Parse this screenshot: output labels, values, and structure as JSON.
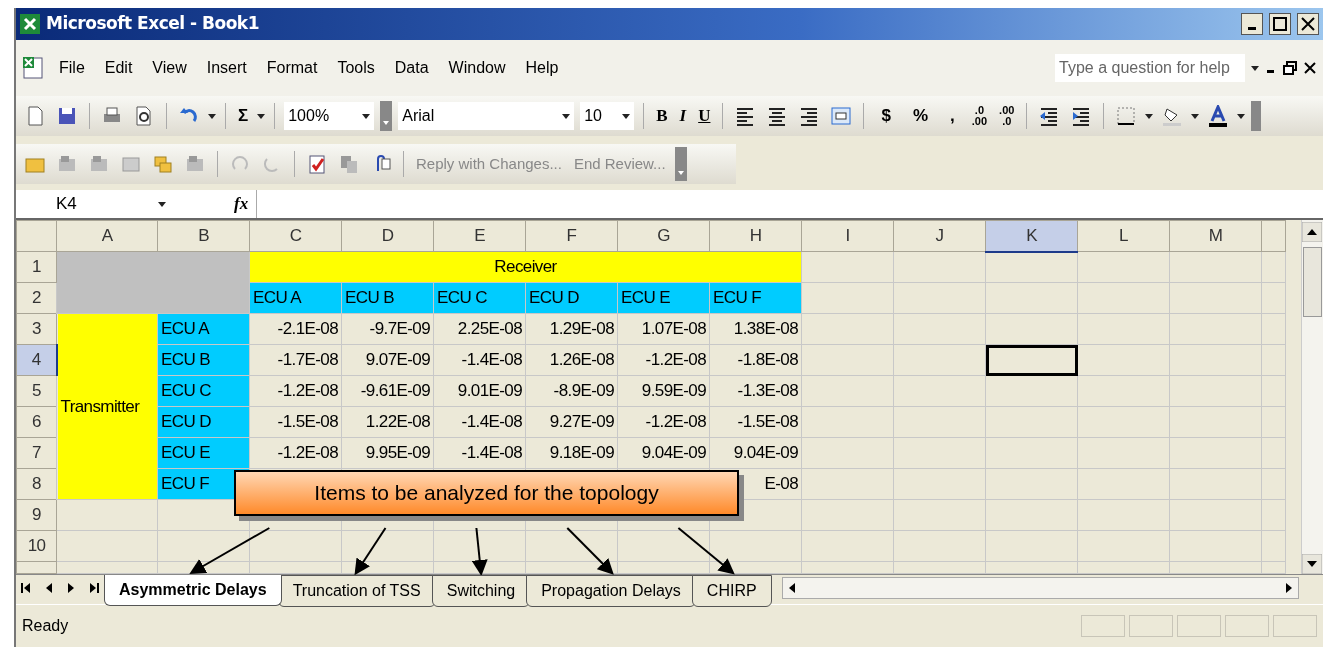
{
  "window": {
    "title": "Microsoft Excel - Book1"
  },
  "menu": [
    "File",
    "Edit",
    "View",
    "Insert",
    "Format",
    "Tools",
    "Data",
    "Window",
    "Help"
  ],
  "help_box": {
    "placeholder": "Type a question for help"
  },
  "toolbar": {
    "sum": "Σ",
    "zoom": "100%",
    "font": "Arial",
    "size": "10",
    "styles": [
      "B",
      "I",
      "U"
    ],
    "number_formats": [
      "$",
      "%",
      ","
    ],
    "increase_decimal": [
      ".0",
      ".00"
    ],
    "decrease_decimal": [
      ".00",
      ".0"
    ]
  },
  "review_toolbar": [
    "Reply with Changes...",
    "End Review..."
  ],
  "name_box": "K4",
  "formula_label": "fx",
  "grid": {
    "columns": [
      {
        "label": "A",
        "selected": false
      },
      {
        "label": "B",
        "selected": false
      },
      {
        "label": "C",
        "selected": false
      },
      {
        "label": "D",
        "selected": false
      },
      {
        "label": "E",
        "selected": false
      },
      {
        "label": "F",
        "selected": false
      },
      {
        "label": "G",
        "selected": false
      },
      {
        "label": "H",
        "selected": false
      },
      {
        "label": "I",
        "selected": false
      },
      {
        "label": "J",
        "selected": false
      },
      {
        "label": "K",
        "selected": true
      },
      {
        "label": "L",
        "selected": false
      },
      {
        "label": "M",
        "selected": false
      }
    ],
    "rows": [
      {
        "label": "1",
        "selected": false
      },
      {
        "label": "2",
        "selected": false
      },
      {
        "label": "3",
        "selected": false
      },
      {
        "label": "4",
        "selected": true
      },
      {
        "label": "5",
        "selected": false
      },
      {
        "label": "6",
        "selected": false
      },
      {
        "label": "7",
        "selected": false
      },
      {
        "label": "8",
        "selected": false
      },
      {
        "label": "9",
        "selected": false
      },
      {
        "label": "10",
        "selected": false
      }
    ],
    "receiver_header": "Receiver",
    "receiver_labels": [
      "ECU A",
      "ECU B",
      "ECU C",
      "ECU D",
      "ECU E",
      "ECU F"
    ],
    "transmitter_header": "Transmitter",
    "transmitter_rows": [
      {
        "label": "ECU A",
        "values": [
          "-2.1E-08",
          "-9.7E-09",
          "2.25E-08",
          "1.29E-08",
          "1.07E-08",
          "1.38E-08"
        ]
      },
      {
        "label": "ECU B",
        "values": [
          "-1.7E-08",
          "9.07E-09",
          "-1.4E-08",
          "1.26E-08",
          "-1.2E-08",
          "-1.8E-08"
        ]
      },
      {
        "label": "ECU C",
        "values": [
          "-1.2E-08",
          "-9.61E-09",
          "9.01E-09",
          "-8.9E-09",
          "9.59E-09",
          "-1.3E-08"
        ]
      },
      {
        "label": "ECU D",
        "values": [
          "-1.5E-08",
          "1.22E-08",
          "-1.4E-08",
          "9.27E-09",
          "-1.2E-08",
          "-1.5E-08"
        ]
      },
      {
        "label": "ECU E",
        "values": [
          "-1.2E-08",
          "9.95E-09",
          "-1.4E-08",
          "9.18E-09",
          "9.04E-09",
          "9.04E-09"
        ]
      },
      {
        "label": "ECU F",
        "values": [
          "E-08"
        ]
      }
    ]
  },
  "callout": {
    "text": "Items to be analyzed for the topology"
  },
  "sheet_tabs": [
    {
      "label": "Asymmetric Delays",
      "selected": true
    },
    {
      "label": "Truncation of TSS",
      "selected": false
    },
    {
      "label": "Switching",
      "selected": false
    },
    {
      "label": "Propagation Delays",
      "selected": false
    },
    {
      "label": "CHIRP",
      "selected": false
    }
  ],
  "status_bar": {
    "text": "Ready"
  }
}
